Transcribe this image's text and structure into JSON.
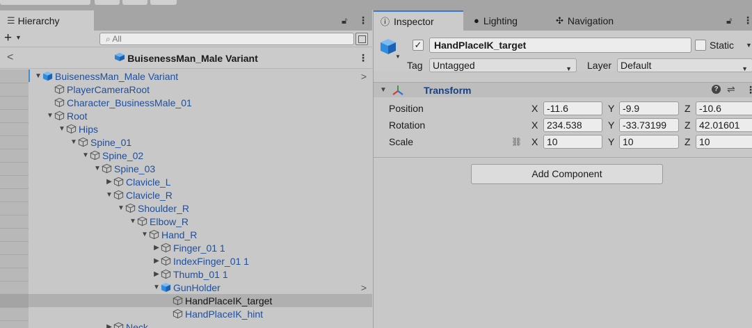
{
  "hierarchy": {
    "tab_label": "Hierarchy",
    "tab_icon": "list-icon",
    "search_placeholder": "All",
    "scene_title": "BuisenessMan_Male Variant",
    "items": [
      {
        "label": "BuisenessMan_Male Variant",
        "depth": 0,
        "arrow": "▼",
        "icon": "prefab-blue",
        "right": ">"
      },
      {
        "label": "PlayerCameraRoot",
        "depth": 1,
        "arrow": "",
        "icon": "gameobject"
      },
      {
        "label": "Character_BusinessMale_01",
        "depth": 1,
        "arrow": "",
        "icon": "gameobject"
      },
      {
        "label": "Root",
        "depth": 1,
        "arrow": "▼",
        "icon": "gameobject"
      },
      {
        "label": "Hips",
        "depth": 2,
        "arrow": "▼",
        "icon": "gameobject"
      },
      {
        "label": "Spine_01",
        "depth": 3,
        "arrow": "▼",
        "icon": "gameobject"
      },
      {
        "label": "Spine_02",
        "depth": 4,
        "arrow": "▼",
        "icon": "gameobject"
      },
      {
        "label": "Spine_03",
        "depth": 5,
        "arrow": "▼",
        "icon": "gameobject"
      },
      {
        "label": "Clavicle_L",
        "depth": 6,
        "arrow": "▶",
        "icon": "gameobject"
      },
      {
        "label": "Clavicle_R",
        "depth": 6,
        "arrow": "▼",
        "icon": "gameobject"
      },
      {
        "label": "Shoulder_R",
        "depth": 7,
        "arrow": "▼",
        "icon": "gameobject"
      },
      {
        "label": "Elbow_R",
        "depth": 8,
        "arrow": "▼",
        "icon": "gameobject"
      },
      {
        "label": "Hand_R",
        "depth": 9,
        "arrow": "▼",
        "icon": "gameobject"
      },
      {
        "label": "Finger_01 1",
        "depth": 10,
        "arrow": "▶",
        "icon": "gameobject"
      },
      {
        "label": "IndexFinger_01 1",
        "depth": 10,
        "arrow": "▶",
        "icon": "gameobject"
      },
      {
        "label": "Thumb_01 1",
        "depth": 10,
        "arrow": "▶",
        "icon": "gameobject"
      },
      {
        "label": "GunHolder",
        "depth": 10,
        "arrow": "▼",
        "icon": "prefab-blue",
        "right": ">"
      },
      {
        "label": "HandPlaceIK_target",
        "depth": 11,
        "arrow": "",
        "icon": "gameobject",
        "selected": true
      },
      {
        "label": "HandPlaceIK_hint",
        "depth": 11,
        "arrow": "",
        "icon": "gameobject"
      },
      {
        "label": "Neck",
        "depth": 6,
        "arrow": "▶",
        "icon": "gameobject"
      }
    ]
  },
  "inspector": {
    "tabs": [
      {
        "label": "Inspector",
        "icon": "info-icon",
        "active": true
      },
      {
        "label": "Lighting",
        "icon": "lightbulb-icon",
        "active": false
      },
      {
        "label": "Navigation",
        "icon": "navigation-icon",
        "active": false
      }
    ],
    "object_name": "HandPlaceIK_target",
    "active_checked": "✓",
    "static_label": "Static",
    "tag_label": "Tag",
    "tag_value": "Untagged",
    "layer_label": "Layer",
    "layer_value": "Default",
    "transform": {
      "title": "Transform",
      "rows": [
        {
          "name": "Position",
          "x": "-11.6",
          "y": "-9.9",
          "z": "-10.6"
        },
        {
          "name": "Rotation",
          "x": "234.538",
          "y": "-33.73199",
          "z": "42.01601"
        },
        {
          "name": "Scale",
          "x": "10",
          "y": "10",
          "z": "10"
        }
      ],
      "axis_x": "X",
      "axis_y": "Y",
      "axis_z": "Z"
    },
    "add_component_label": "Add Component"
  },
  "colors": {
    "accent": "#3a79d3",
    "prefab_blue": "#2f8de0",
    "tree_text": "#1e4f9e"
  }
}
